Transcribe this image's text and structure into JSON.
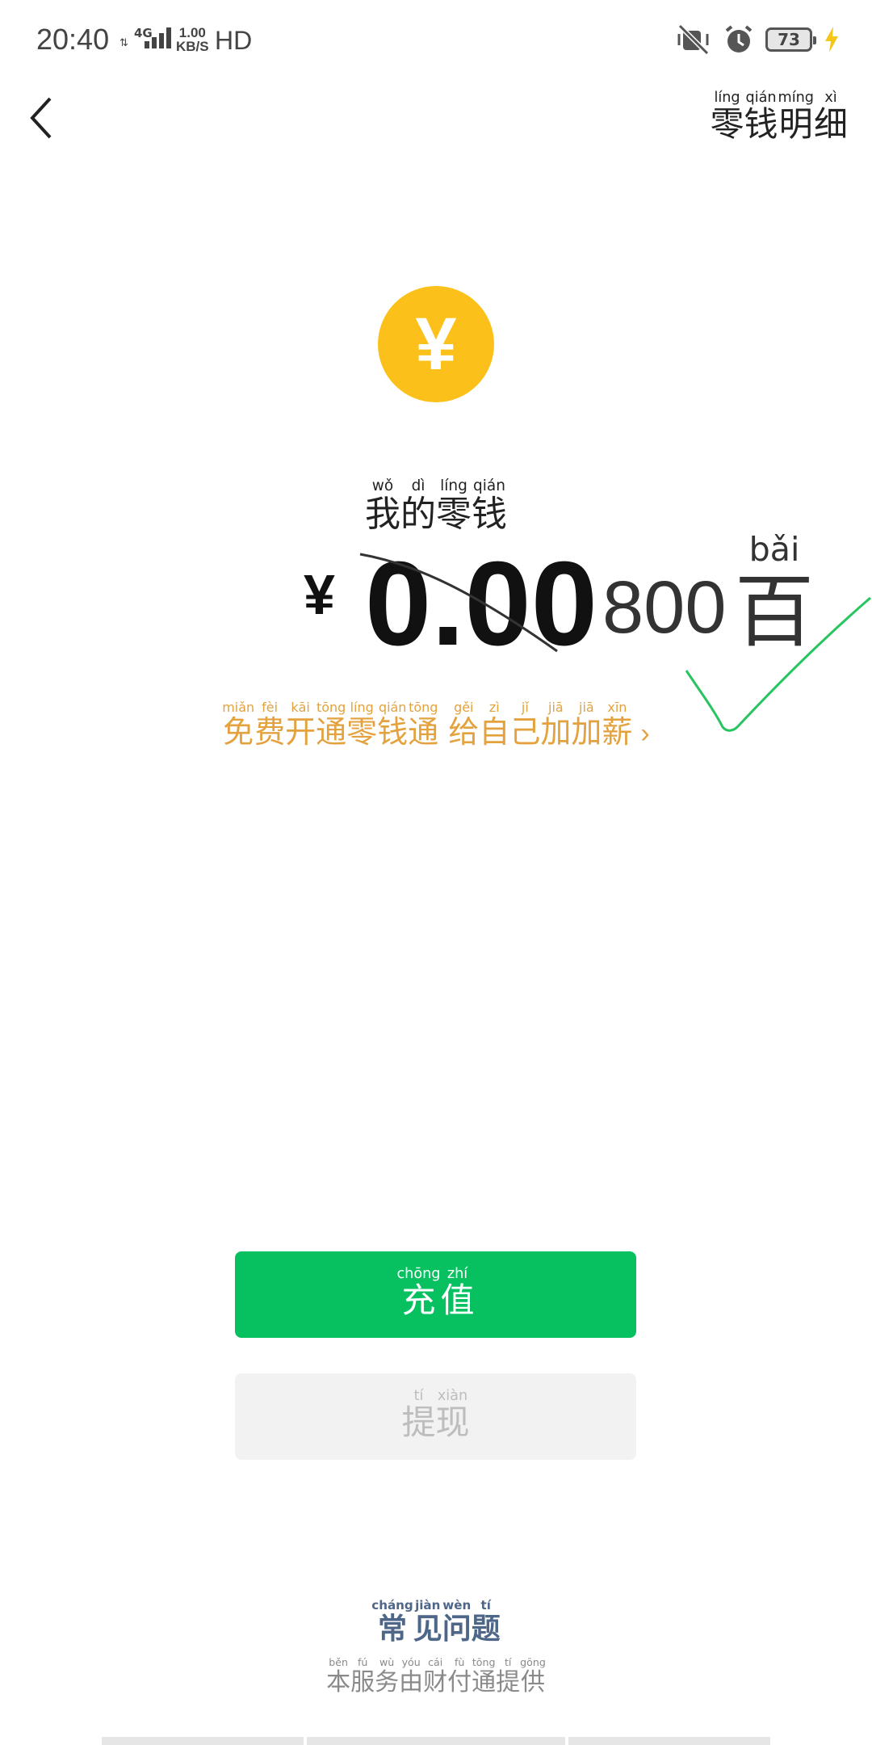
{
  "status_bar": {
    "time": "20:40",
    "network": "4G",
    "speed_value": "1.00",
    "speed_unit": "KB/S",
    "hd": "HD",
    "battery": "73"
  },
  "nav": {
    "detail": [
      {
        "char": "零",
        "py": "líng"
      },
      {
        "char": "钱",
        "py": "qián"
      },
      {
        "char": "明",
        "py": "míng"
      },
      {
        "char": "细",
        "py": "xì"
      }
    ]
  },
  "coin": {
    "symbol": "¥"
  },
  "balance": {
    "label": [
      {
        "char": "我",
        "py": "wǒ"
      },
      {
        "char": "的",
        "py": "dì"
      },
      {
        "char": "零",
        "py": "líng"
      },
      {
        "char": "钱",
        "py": "qián"
      }
    ],
    "currency": "¥",
    "amount": "0.00",
    "handwritten_amount": "800",
    "handwritten_unit": {
      "char": "百",
      "py": "bǎi"
    }
  },
  "promo": {
    "text": [
      {
        "char": "免",
        "py": "miǎn"
      },
      {
        "char": "费",
        "py": "fèi"
      },
      {
        "char": "开",
        "py": "kāi"
      },
      {
        "char": "通",
        "py": "tōng"
      },
      {
        "char": "零",
        "py": "líng"
      },
      {
        "char": "钱",
        "py": "qián"
      },
      {
        "char": "通",
        "py": "tōng"
      },
      {
        "char": " ",
        "py": ""
      },
      {
        "char": "给",
        "py": "gěi"
      },
      {
        "char": "自",
        "py": "zì"
      },
      {
        "char": "己",
        "py": "jǐ"
      },
      {
        "char": "加",
        "py": "jiā"
      },
      {
        "char": "加",
        "py": "jiā"
      },
      {
        "char": "薪",
        "py": "xīn"
      }
    ],
    "arrow": "›"
  },
  "buttons": {
    "recharge": [
      {
        "char": "充",
        "py": "chōng"
      },
      {
        "char": "值",
        "py": "zhí"
      }
    ],
    "withdraw": [
      {
        "char": "提",
        "py": "tí"
      },
      {
        "char": "现",
        "py": "xiàn"
      }
    ]
  },
  "footer": {
    "faq": [
      {
        "char": "常",
        "py": "cháng"
      },
      {
        "char": "见",
        "py": "jiàn"
      },
      {
        "char": "问",
        "py": "wèn"
      },
      {
        "char": "题",
        "py": "tí"
      }
    ],
    "provider": [
      {
        "char": "本",
        "py": "běn"
      },
      {
        "char": "服",
        "py": "fú"
      },
      {
        "char": "务",
        "py": "wù"
      },
      {
        "char": "由",
        "py": "yóu"
      },
      {
        "char": "财",
        "py": "cái"
      },
      {
        "char": "付",
        "py": "fù"
      },
      {
        "char": "通",
        "py": "tōng"
      },
      {
        "char": "提",
        "py": "tí"
      },
      {
        "char": "供",
        "py": "gōng"
      }
    ]
  },
  "colors": {
    "primary_green": "#07c160",
    "coin_yellow": "#fbc11a",
    "promo_orange": "#e3a23e",
    "faq_blue": "#4e6688"
  }
}
